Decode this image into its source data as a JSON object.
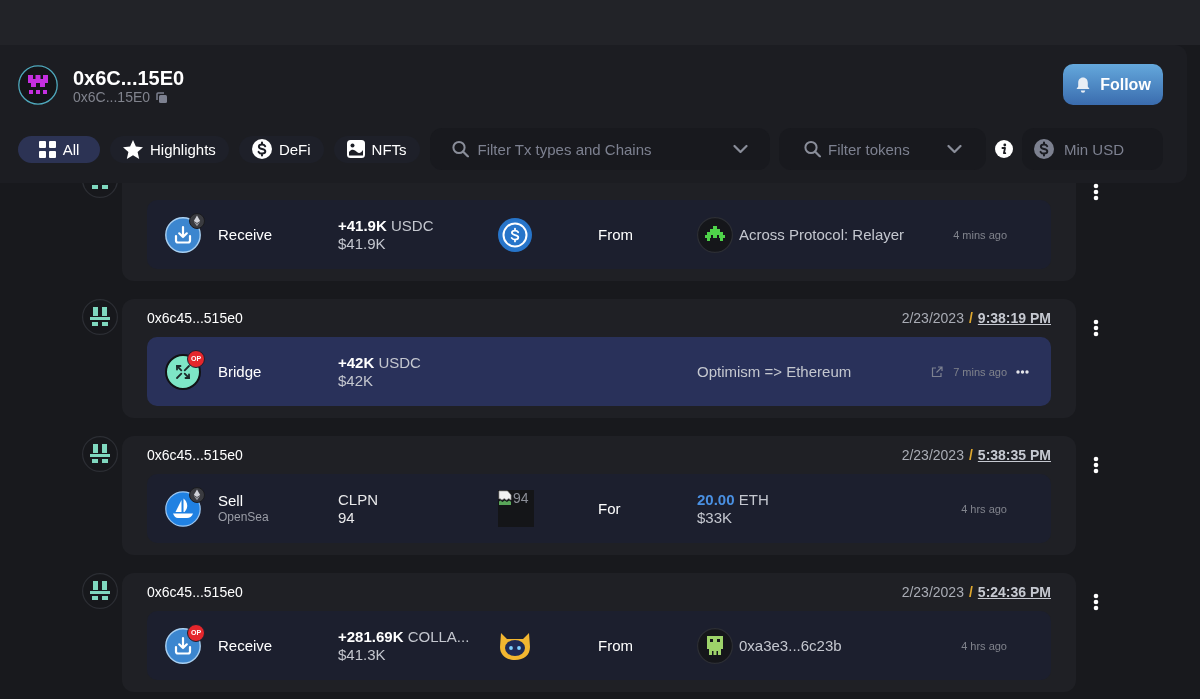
{
  "profile": {
    "name": "0x6C...15E0",
    "address": "0x6C...15E0"
  },
  "follow_button": {
    "label": "Follow"
  },
  "filters": {
    "tabs": [
      {
        "kind": "all",
        "label": "All",
        "selected": true
      },
      {
        "kind": "highlights",
        "label": "Highlights",
        "selected": false
      },
      {
        "kind": "defi",
        "label": "DeFi",
        "selected": false
      },
      {
        "kind": "nfts",
        "label": "NFTs",
        "selected": false
      }
    ],
    "tx_type_filter": {
      "placeholder": "Filter Tx types and Chains"
    },
    "token_filter": {
      "placeholder": "Filter tokens"
    },
    "min_usd": {
      "placeholder": "Min USD"
    }
  },
  "activity": [
    {
      "transaction": {
        "kind": "receive",
        "chain": {
          "kind": "eth"
        },
        "selected": false,
        "action": {
          "label": "Receive"
        },
        "amount": {
          "text": "**+41.9K** USDC",
          "usd": "$41.9K"
        },
        "token": {
          "kind": "usdc"
        },
        "direction": "From",
        "counterparty": {
          "kind": "invader",
          "name": "Across Protocol: Relayer"
        },
        "time_ago": "4 mins ago"
      }
    },
    {
      "address": "0x6c45...515e0",
      "date": "2/23/2023",
      "separator": "/",
      "time": "9:38:19 PM",
      "transaction": {
        "kind": "bridge",
        "chain": {
          "kind": "op",
          "label": "OP"
        },
        "selected": true,
        "action": {
          "label": "Bridge"
        },
        "amount": {
          "text": "**+42K** USDC",
          "usd": "$42K"
        },
        "route": "Optimism => Ethereum",
        "time_ago": "7 mins ago"
      }
    },
    {
      "address": "0x6c45...515e0",
      "date": "2/23/2023",
      "separator": "/",
      "time": "5:38:35 PM",
      "transaction": {
        "kind": "sell",
        "chain": {
          "kind": "eth"
        },
        "selected": false,
        "action": {
          "label": "Sell",
          "platform": "OpenSea"
        },
        "item": {
          "collection": "CLPN",
          "token_id": "94"
        },
        "token": {
          "kind": "nft",
          "alt": "94"
        },
        "direction": "For",
        "price": {
          "text": "**20.00** ETH",
          "usd": "$33K"
        },
        "time_ago": "4 hrs ago"
      }
    },
    {
      "address": "0x6c45...515e0",
      "date": "2/23/2023",
      "separator": "/",
      "time": "5:24:36 PM",
      "transaction": {
        "kind": "receive",
        "chain": {
          "kind": "op",
          "label": "OP"
        },
        "selected": false,
        "action": {
          "label": "Receive"
        },
        "amount": {
          "text": "**+281.69K** COLLA...",
          "usd": "$41.3K"
        },
        "token": {
          "kind": "mascot"
        },
        "direction": "From",
        "counterparty": {
          "kind": "pixel-face",
          "name": "0xa3e3...6c23b"
        },
        "time_ago": "4 hrs ago"
      }
    }
  ]
}
